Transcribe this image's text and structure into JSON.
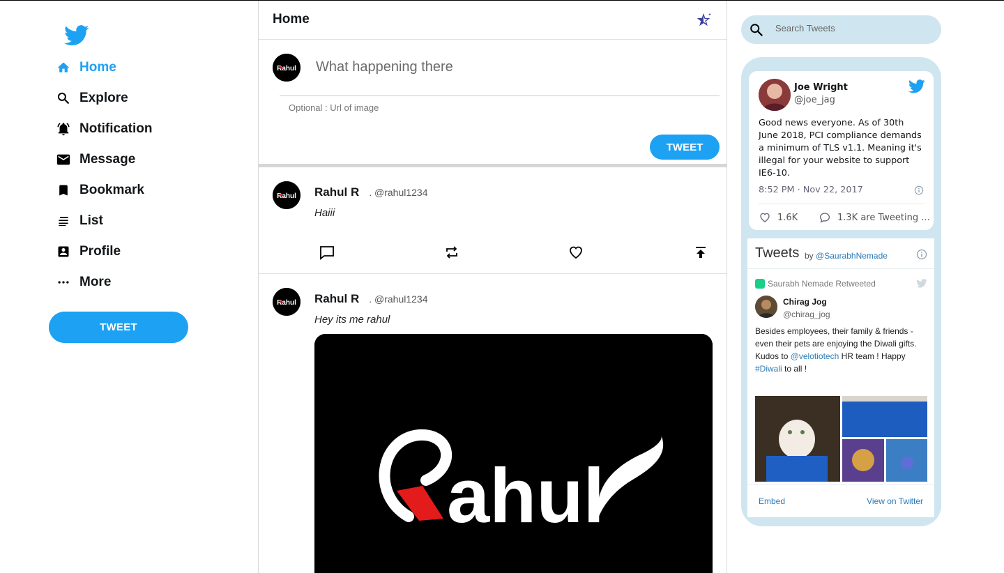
{
  "sidebar": {
    "logo_icon": "twitter-bird-icon",
    "items": [
      {
        "label": "Home",
        "icon": "home-icon",
        "active": true
      },
      {
        "label": "Explore",
        "icon": "search-icon"
      },
      {
        "label": "Notification",
        "icon": "bell-icon"
      },
      {
        "label": "Message",
        "icon": "mail-icon"
      },
      {
        "label": "Bookmark",
        "icon": "bookmark-icon"
      },
      {
        "label": "List",
        "icon": "list-icon"
      },
      {
        "label": "Profile",
        "icon": "profile-icon"
      },
      {
        "label": "More",
        "icon": "more-icon"
      }
    ],
    "tweet_button": "TWEET"
  },
  "header": {
    "title": "Home"
  },
  "compose": {
    "placeholder": "What happening there",
    "image_placeholder": "Optional : Url of image",
    "tweet_button": "TWEET"
  },
  "posts": [
    {
      "name": "Rahul R",
      "handle": ". @rahul1234",
      "text": "Haiii"
    },
    {
      "name": "Rahul R",
      "handle": ". @rahul1234",
      "text": "Hey its me rahul"
    }
  ],
  "search": {
    "placeholder": "Search Tweets"
  },
  "embedded_tweet": {
    "name": "Joe Wright",
    "handle": "@joe_jag",
    "text": "Good news everyone. As of 30th June 2018, PCI compliance demands a minimum of TLS v1.1. Meaning it's illegal for your website to support IE6-10.",
    "time": "8:52 PM · Nov 22, 2017",
    "likes": "1.6K",
    "talking": "1.3K are Tweeting ..."
  },
  "timeline": {
    "title": "Tweets",
    "by": "by",
    "by_handle": "@SaurabhNemade",
    "retweeted": "Saurabh Nemade Retweeted",
    "author_name": "Chirag Jog",
    "author_handle": "@chirag_jog",
    "text_1": "Besides employees, their family & friends - even their pets are enjoying the Diwali gifts. Kudos to ",
    "mention": "@velotiotech",
    "text_2": " HR team ! Happy ",
    "hashtag": "#Diwali",
    "text_3": " to all !",
    "embed": "Embed",
    "view_on_twitter": "View on Twitter"
  },
  "colors": {
    "accent": "#1da1f2",
    "panel": "#cfe6f0",
    "link": "#2b7bb9"
  }
}
